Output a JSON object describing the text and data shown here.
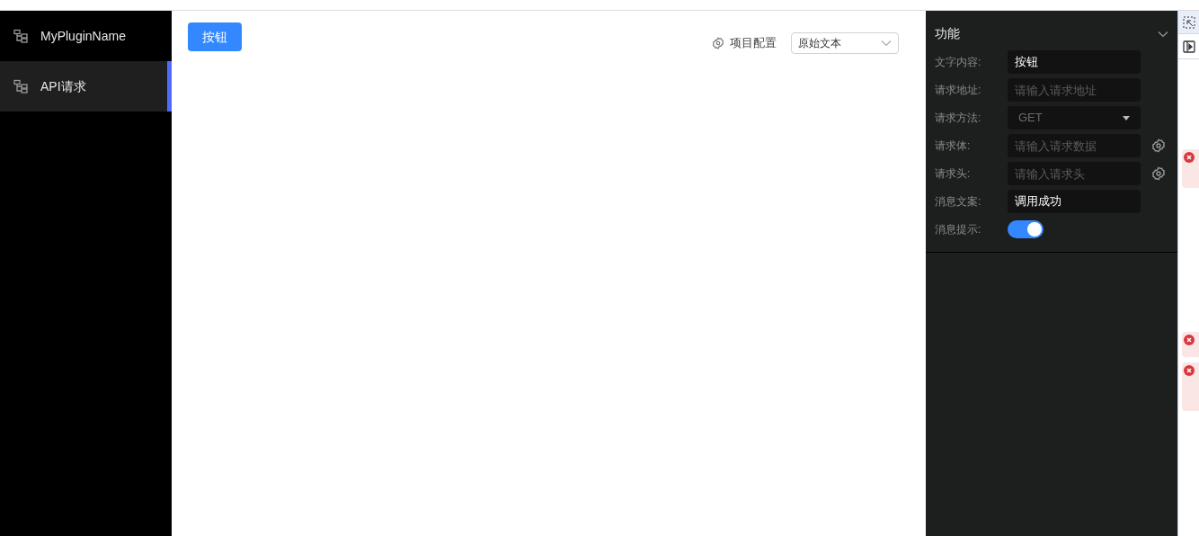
{
  "sidebar": {
    "items": [
      {
        "label": "MyPluginName",
        "selected": false
      },
      {
        "label": "API请求",
        "selected": true
      }
    ]
  },
  "canvas": {
    "button": "按钮",
    "project_config": "项目配置",
    "mode_select": {
      "value": "原始文本"
    }
  },
  "panel": {
    "title": "功能",
    "expanded": true,
    "fields": [
      {
        "kind": "input",
        "label": "文字内容:",
        "value": "按钮"
      },
      {
        "kind": "input",
        "label": "请求地址:",
        "placeholder": "请输入请求地址"
      },
      {
        "kind": "select",
        "label": "请求方法:",
        "value": "GET"
      },
      {
        "kind": "input_gear",
        "label": "请求体:",
        "placeholder": "请输入请求数据"
      },
      {
        "kind": "input_gear",
        "label": "请求头:",
        "placeholder": "请输入请求头"
      },
      {
        "kind": "input",
        "label": "消息文案:",
        "value": "调用成功"
      },
      {
        "kind": "switch",
        "label": "消息提示:",
        "on": true
      }
    ]
  }
}
